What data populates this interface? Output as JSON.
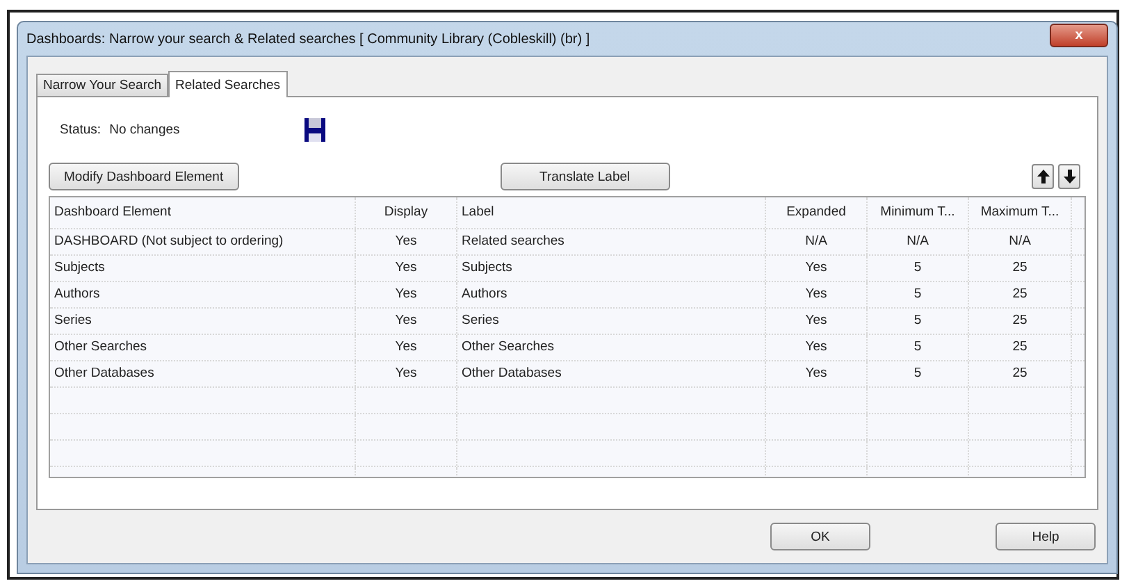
{
  "window": {
    "title": "Dashboards: Narrow your search & Related searches [ Community Library (Cobleskill) (br) ]",
    "close": "x"
  },
  "tabs": [
    {
      "label": "Narrow Your Search",
      "selected": false
    },
    {
      "label": "Related Searches",
      "selected": true
    }
  ],
  "status": {
    "label": "Status:",
    "value": "No changes"
  },
  "toolbar": {
    "modify": "Modify Dashboard Element",
    "translate": "Translate Label"
  },
  "table": {
    "columns": [
      "Dashboard Element",
      "Display",
      "Label",
      "Expanded",
      "Minimum T...",
      "Maximum T..."
    ],
    "rows": [
      [
        "DASHBOARD (Not subject to ordering)",
        "Yes",
        "Related searches",
        "N/A",
        "N/A",
        "N/A"
      ],
      [
        "Subjects",
        "Yes",
        "Subjects",
        "Yes",
        "5",
        "25"
      ],
      [
        "Authors",
        "Yes",
        "Authors",
        "Yes",
        "5",
        "25"
      ],
      [
        "Series",
        "Yes",
        "Series",
        "Yes",
        "5",
        "25"
      ],
      [
        "Other Searches",
        "Yes",
        "Other Searches",
        "Yes",
        "5",
        "25"
      ],
      [
        "Other Databases",
        "Yes",
        "Other Databases",
        "Yes",
        "5",
        "25"
      ]
    ]
  },
  "buttons": [
    "OK",
    "Help"
  ]
}
